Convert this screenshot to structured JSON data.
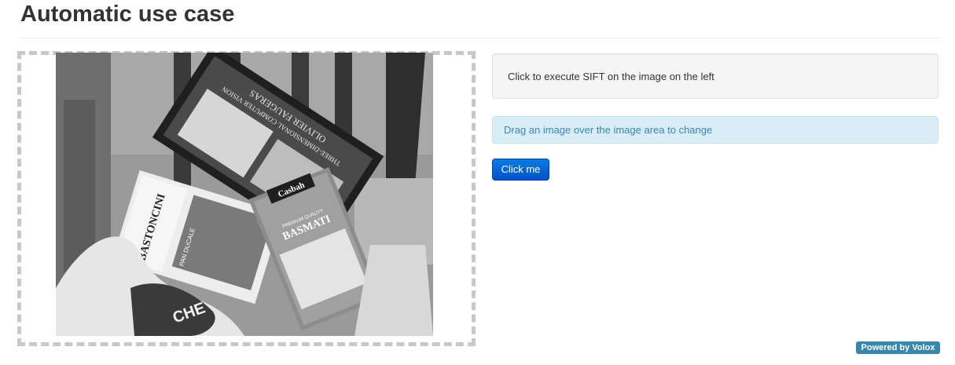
{
  "page": {
    "title": "Automatic use case"
  },
  "image_area": {
    "packages": {
      "book_author": "OLIVIER FAUGERAS",
      "book_title": "THREE-DIMENSIONAL COMPUTER VISION",
      "pasta_brand": "BASTONCINI",
      "pasta_sub": "PAN DUCALE",
      "rice_brand": "Casbah",
      "rice_kind": "BASMATI",
      "rice_sub": "PREMIUM QUALITY",
      "bag_text": "CHE"
    }
  },
  "instructions": {
    "execute_text": "Click to execute SIFT on the image on the left",
    "drag_text": "Drag an image over the image area to change"
  },
  "actions": {
    "button_label": "Click me"
  },
  "footer": {
    "badge": "Powered by Volox"
  }
}
